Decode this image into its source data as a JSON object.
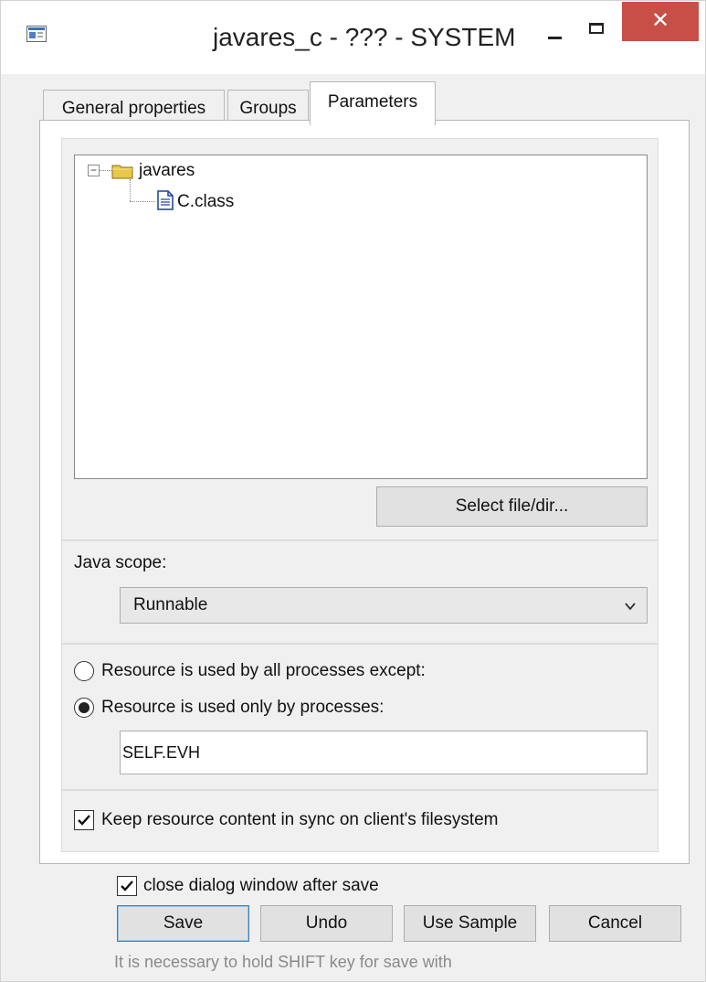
{
  "window": {
    "title": "javares_c - ??? - SYSTEM",
    "close_glyph": "✕"
  },
  "tabs": [
    {
      "label": "General properties",
      "active": false
    },
    {
      "label": "Groups",
      "active": false
    },
    {
      "label": "Parameters",
      "active": true
    }
  ],
  "tree": {
    "toggle_glyph": "−",
    "root": {
      "label": "javares",
      "icon": "folder-icon"
    },
    "child": {
      "label": "C.class",
      "icon": "file-icon"
    }
  },
  "select_file_button": "Select file/dir...",
  "java_scope": {
    "label": "Java scope:",
    "value": "Runnable"
  },
  "resource_usage": {
    "option_all_except": "Resource is used by all processes except:",
    "option_only_by": "Resource is used only by processes:",
    "selected": "only_by",
    "processes_value": "SELF.EVH"
  },
  "sync": {
    "label": "Keep resource content in sync on client's filesystem",
    "checked": true
  },
  "close_after_save": {
    "label": "close dialog window after save",
    "checked": true
  },
  "buttons": {
    "save": "Save",
    "undo": "Undo",
    "use_sample": "Use Sample",
    "cancel": "Cancel"
  },
  "hint": "It is necessary to hold SHIFT key for save with",
  "colors": {
    "close_button": "#c74f48",
    "folder": "#e8c84a",
    "file_outline": "#1b3f9c"
  }
}
